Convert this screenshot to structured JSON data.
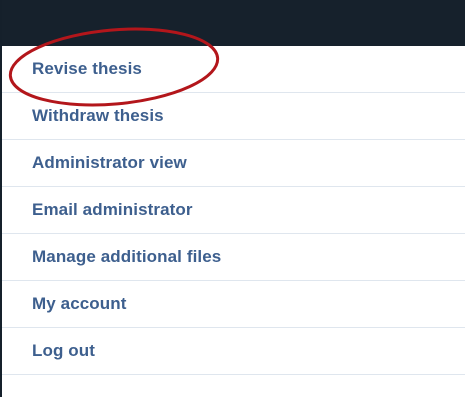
{
  "menu": {
    "items": [
      {
        "label": "Revise thesis"
      },
      {
        "label": "Withdraw thesis"
      },
      {
        "label": "Administrator view"
      },
      {
        "label": "Email administrator"
      },
      {
        "label": "Manage additional files"
      },
      {
        "label": "My account"
      },
      {
        "label": "Log out"
      }
    ]
  },
  "annotation": {
    "highlight_color": "#b3161b"
  },
  "colors": {
    "header_background": "#16212c",
    "link_color": "#3d5f8e",
    "divider_color": "#dfe6ee"
  }
}
